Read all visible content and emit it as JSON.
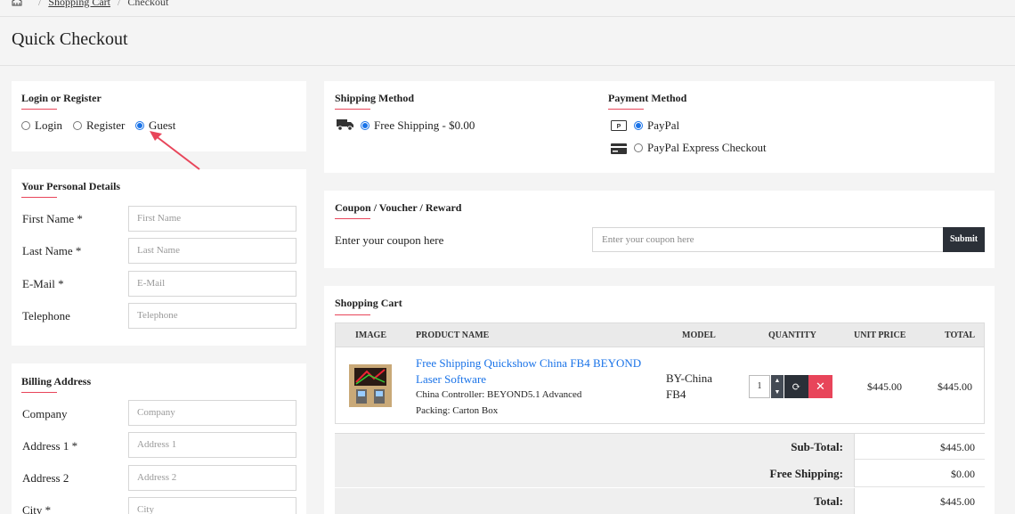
{
  "breadcrumb": {
    "items": [
      "Shopping Cart",
      "Checkout"
    ]
  },
  "page": {
    "title": "Quick Checkout"
  },
  "login": {
    "title": "Login or Register",
    "options": [
      "Login",
      "Register",
      "Guest"
    ],
    "selected": "Guest"
  },
  "personal": {
    "title": "Your Personal Details",
    "fields": [
      {
        "label": "First Name *",
        "placeholder": "First Name"
      },
      {
        "label": "Last Name *",
        "placeholder": "Last Name"
      },
      {
        "label": "E-Mail *",
        "placeholder": "E-Mail"
      },
      {
        "label": "Telephone",
        "placeholder": "Telephone"
      }
    ]
  },
  "billing": {
    "title": "Billing Address",
    "fields": [
      {
        "label": "Company",
        "placeholder": "Company"
      },
      {
        "label": "Address 1 *",
        "placeholder": "Address 1"
      },
      {
        "label": "Address 2",
        "placeholder": "Address 2"
      },
      {
        "label": "City *",
        "placeholder": "City"
      }
    ]
  },
  "shipping": {
    "title": "Shipping Method",
    "option": "Free Shipping - $0.00",
    "icon": "truck-icon"
  },
  "payment": {
    "title": "Payment Method",
    "options": [
      {
        "label": "PayPal",
        "icon": "paypal-icon",
        "selected": true
      },
      {
        "label": "PayPal Express Checkout",
        "icon": "credit-card-icon",
        "selected": false
      }
    ]
  },
  "coupon": {
    "title": "Coupon / Voucher / Reward",
    "label": "Enter your coupon here",
    "placeholder": "Enter your coupon here",
    "button": "Submit"
  },
  "cart": {
    "title": "Shopping Cart",
    "columns": [
      "IMAGE",
      "PRODUCT NAME",
      "MODEL",
      "QUANTITY",
      "UNIT PRICE",
      "TOTAL"
    ],
    "item": {
      "name_line1": "Free Shipping Quickshow China FB4 BEYOND",
      "name_line2": "Laser Software",
      "option1": "China Controller: BEYOND5.1 Advanced",
      "option2": "Packing: Carton Box",
      "model_line1": "BY-China",
      "model_line2": "FB4",
      "quantity": "1",
      "unit_price": "$445.00",
      "total": "$445.00"
    },
    "totals": [
      {
        "label": "Sub-Total:",
        "value": "$445.00"
      },
      {
        "label": "Free Shipping:",
        "value": "$0.00"
      },
      {
        "label": "Total:",
        "value": "$445.00"
      }
    ]
  },
  "colors": {
    "accent": "#e8455a",
    "link": "#1a73e8",
    "dark_button": "#2b3038"
  }
}
